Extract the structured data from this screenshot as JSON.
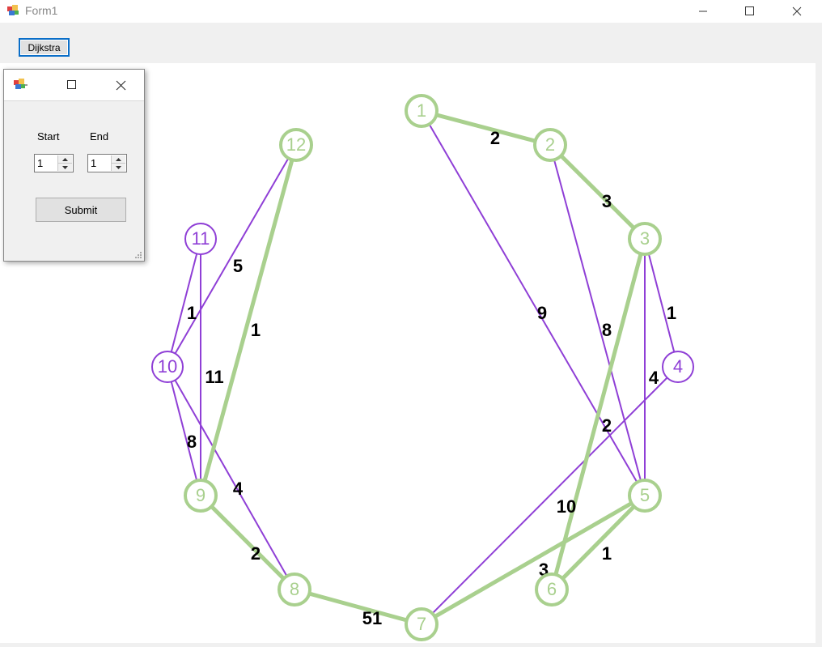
{
  "window": {
    "title": "Form1",
    "minimize_glyph": "—",
    "maximize_glyph": "☐",
    "close_glyph": "✕"
  },
  "toolbar": {
    "dijkstra_label": "Dijkstra"
  },
  "dialog": {
    "start_label": "Start",
    "end_label": "End",
    "start_value": "1",
    "end_value": "1",
    "submit_label": "Submit"
  },
  "colors": {
    "path_node": "#a9d08e",
    "path_edge": "#a9d08e",
    "other_node": "#8f3fd6",
    "other_edge": "#8f3fd6"
  },
  "graph": {
    "nodes": [
      {
        "id": "1",
        "on_path": true
      },
      {
        "id": "2",
        "on_path": true
      },
      {
        "id": "3",
        "on_path": true
      },
      {
        "id": "4",
        "on_path": false
      },
      {
        "id": "5",
        "on_path": true
      },
      {
        "id": "6",
        "on_path": true
      },
      {
        "id": "7",
        "on_path": true
      },
      {
        "id": "8",
        "on_path": true
      },
      {
        "id": "9",
        "on_path": true
      },
      {
        "id": "10",
        "on_path": false
      },
      {
        "id": "11",
        "on_path": false
      },
      {
        "id": "12",
        "on_path": true
      }
    ],
    "edges": [
      {
        "from": "1",
        "to": "2",
        "weight": "2",
        "on_path": true
      },
      {
        "from": "2",
        "to": "3",
        "weight": "3",
        "on_path": true
      },
      {
        "from": "3",
        "to": "4",
        "weight": "1",
        "on_path": false
      },
      {
        "from": "3",
        "to": "5",
        "weight": "4",
        "on_path": false
      },
      {
        "from": "3",
        "to": "6",
        "weight": "2",
        "on_path": true
      },
      {
        "from": "2",
        "to": "5",
        "weight": "8",
        "on_path": false
      },
      {
        "from": "1",
        "to": "5",
        "weight": "9",
        "on_path": false
      },
      {
        "from": "4",
        "to": "7",
        "weight": "10",
        "on_path": false
      },
      {
        "from": "5",
        "to": "6",
        "weight": "1",
        "on_path": true
      },
      {
        "from": "5",
        "to": "7",
        "weight": "3",
        "on_path": true
      },
      {
        "from": "7",
        "to": "8",
        "weight": "51",
        "on_path": true
      },
      {
        "from": "8",
        "to": "9",
        "weight": "2",
        "on_path": true
      },
      {
        "from": "8",
        "to": "10",
        "weight": "4",
        "on_path": false
      },
      {
        "from": "9",
        "to": "10",
        "weight": "8",
        "on_path": false
      },
      {
        "from": "9",
        "to": "11",
        "weight": "11",
        "on_path": false
      },
      {
        "from": "9",
        "to": "12",
        "weight": "1",
        "on_path": true
      },
      {
        "from": "10",
        "to": "11",
        "weight": "1",
        "on_path": false
      },
      {
        "from": "10",
        "to": "12",
        "weight": "5",
        "on_path": false
      }
    ]
  }
}
